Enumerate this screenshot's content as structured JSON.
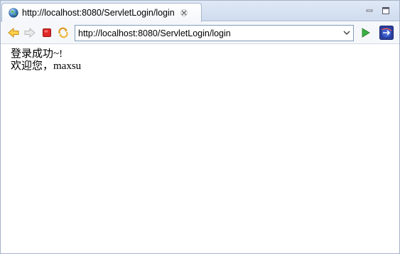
{
  "tab": {
    "title": "http://localhost:8080/ServletLogin/login"
  },
  "toolbar": {
    "url": "http://localhost:8080/ServletLogin/login"
  },
  "content": {
    "line1": "登录成功~!",
    "line2": "欢迎您，maxsu"
  },
  "icons": {
    "tab": "globe-icon",
    "close": "close-icon",
    "minimize": "minimize-icon",
    "maximize": "maximize-icon",
    "back": "back-arrow-icon",
    "forward": "forward-arrow-icon",
    "stop": "stop-icon",
    "refresh": "refresh-icon",
    "dropdown": "chevron-down-icon",
    "go": "go-play-icon",
    "external": "external-browser-icon"
  },
  "colors": {
    "back_arrow": "#f0a020",
    "forward_arrow": "#c8c8c8",
    "stop": "#e02020",
    "go": "#2aa02a"
  }
}
